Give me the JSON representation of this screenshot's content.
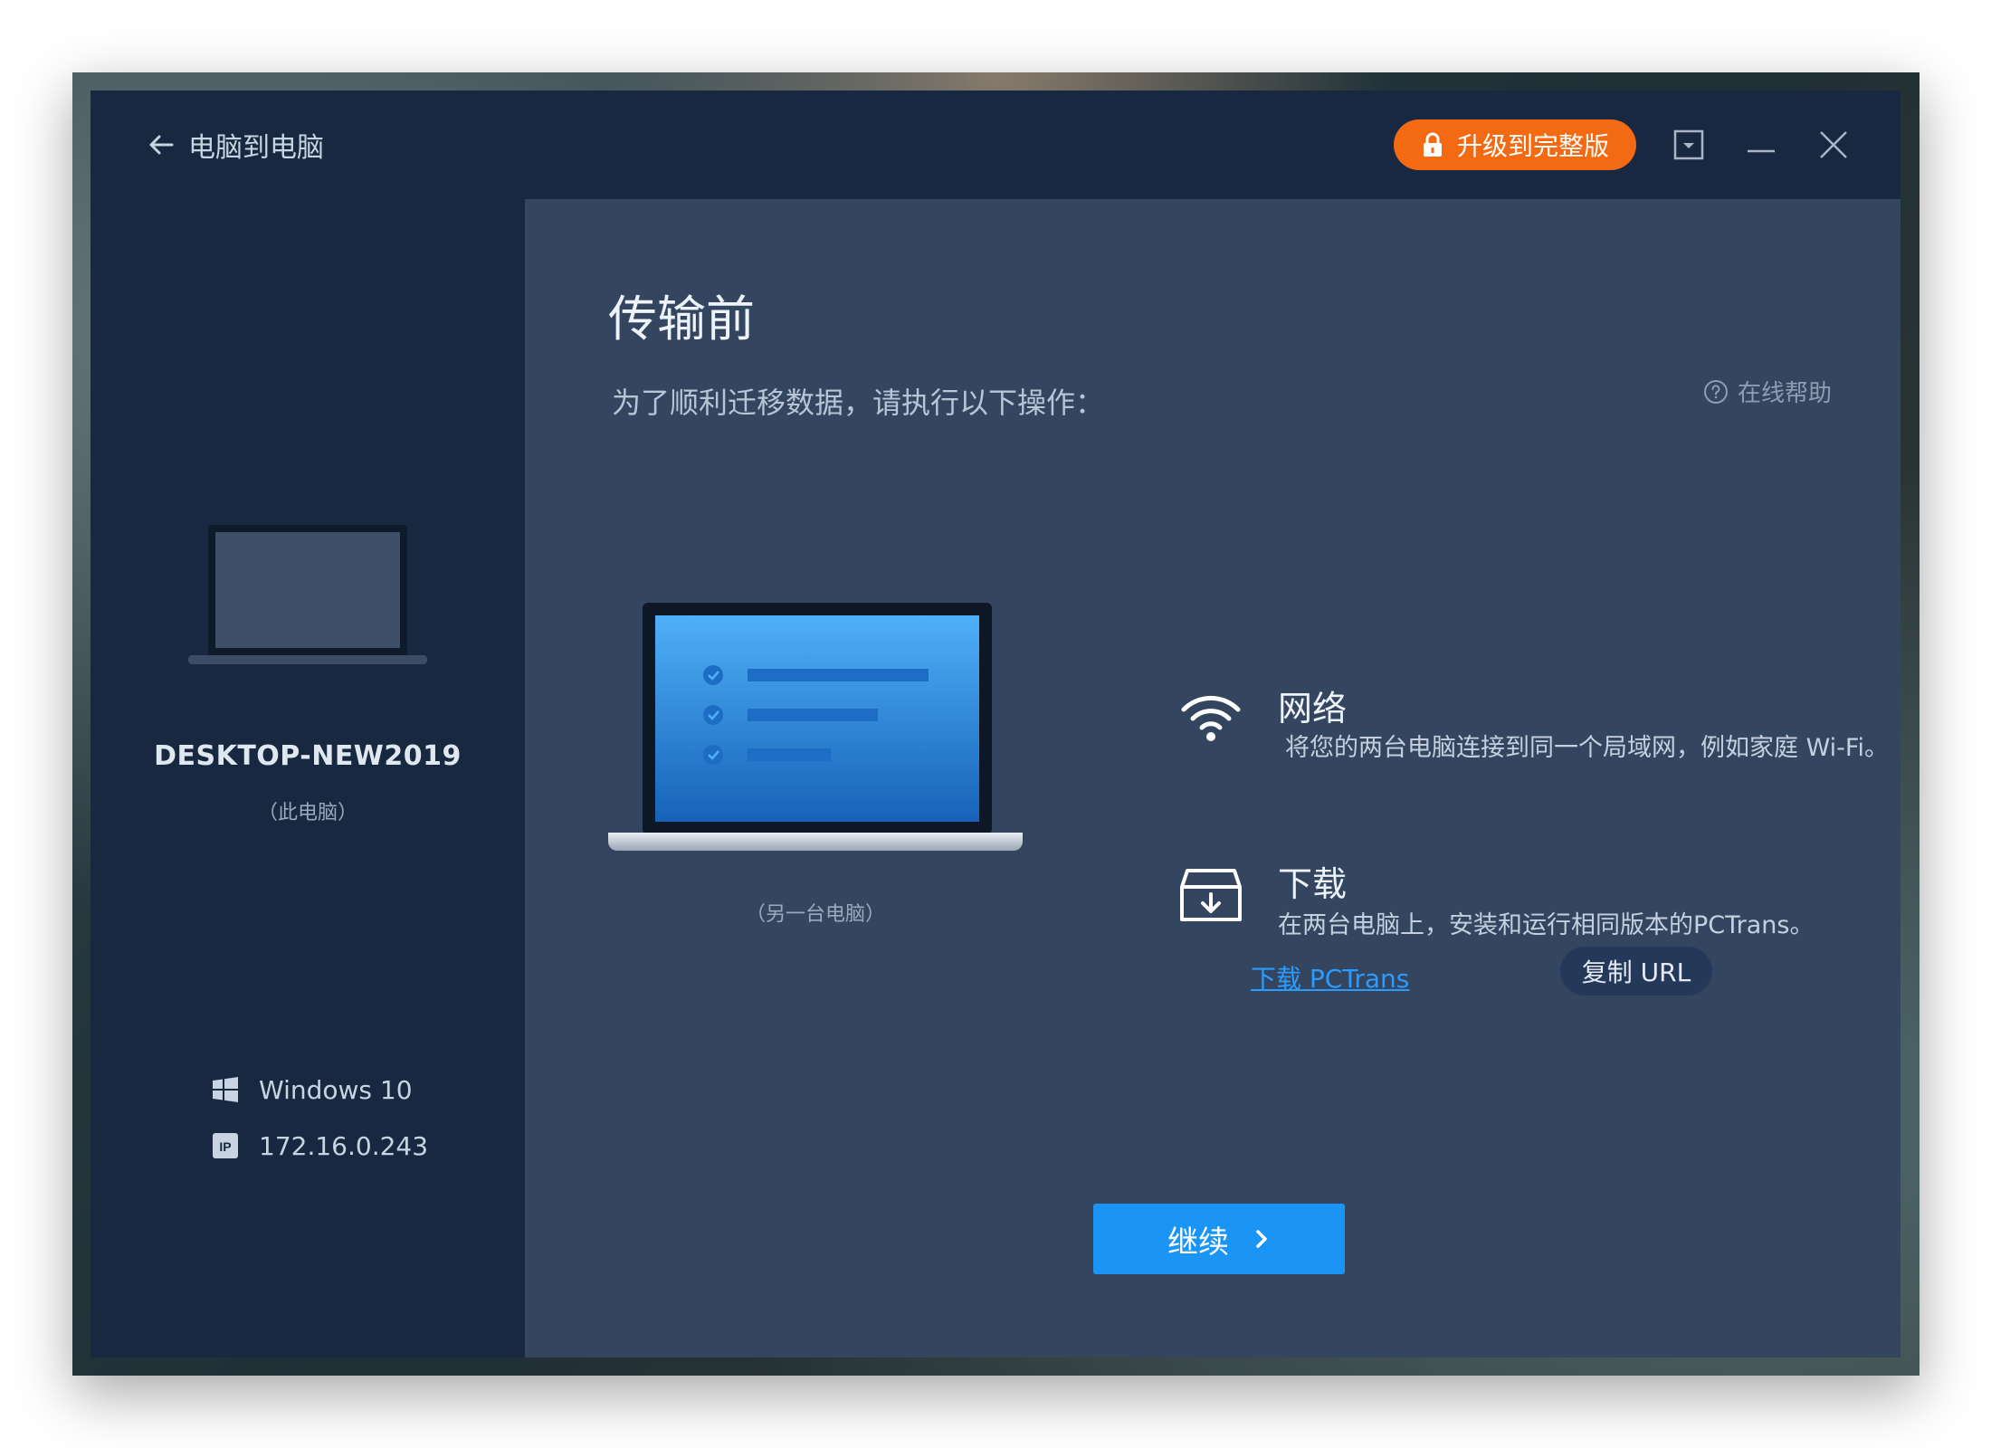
{
  "window": {
    "title": "电脑到电脑",
    "upgrade_label": "升级到完整版",
    "icons": [
      "back-arrow-icon",
      "lock-icon",
      "dropdown-menu-icon",
      "minimize-icon",
      "close-icon"
    ]
  },
  "sidebar": {
    "pc_name": "DESKTOP-NEW2019",
    "pc_sub": "（此电脑）",
    "os": "Windows 10",
    "ip": "172.16.0.243"
  },
  "main": {
    "title": "传输前",
    "subtitle": "为了顺利迁移数据，请执行以下操作：",
    "help_label": "在线帮助",
    "other_pc_label": "（另一台电脑）",
    "steps": [
      {
        "title": "网络",
        "desc": "将您的两台电脑连接到同一个局域网，例如家庭 Wi-Fi。",
        "icon": "wifi-icon"
      },
      {
        "title": "下载",
        "desc": "在两台电脑上，安装和运行相同版本的PCTrans。",
        "icon": "download-box-icon"
      }
    ],
    "download_link": "下载 PCTrans",
    "copy_url_label": "复制 URL",
    "continue_label": "继续"
  },
  "colors": {
    "accent_blue": "#1a95f5",
    "upgrade_orange": "#f36a12",
    "link_blue": "#2b9bff",
    "sidebar_bg": "#172840",
    "main_bg": "#34465f"
  }
}
